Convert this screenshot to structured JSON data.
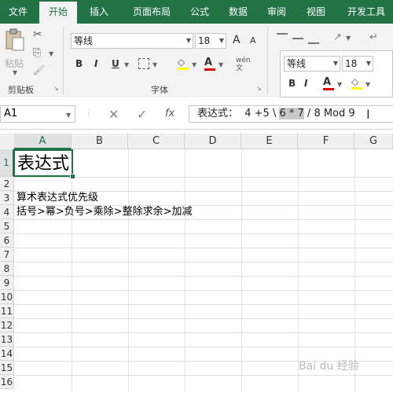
{
  "tabs": [
    "文件",
    "开始",
    "插入",
    "页面布局",
    "公式",
    "数据",
    "审阅",
    "视图",
    "开发工具"
  ],
  "ribbon": {
    "clipboard": {
      "paste": "粘贴",
      "label": "剪贴板"
    },
    "font": {
      "family": "等线",
      "size": "18",
      "label": "字体",
      "bold": "B",
      "italic": "I",
      "underline": "U",
      "grow": "A",
      "shrink": "A",
      "wen": "wén 文"
    },
    "font2": {
      "family": "等线",
      "size": "18",
      "bold": "B",
      "italic": "I"
    },
    "color_font": "#e00000"
  },
  "formula_bar": {
    "name_box": "A1",
    "fx": "fx",
    "formula_pre": "表达式：  4 +5 \\ ",
    "formula_hl": "6 * 7",
    "formula_post": " / 8 Mod 9"
  },
  "grid": {
    "columns": [
      "A",
      "B",
      "C",
      "D",
      "E",
      "F",
      "G"
    ],
    "rows": [
      "1",
      "2",
      "3",
      "4",
      "5",
      "6",
      "7",
      "8",
      "9",
      "10",
      "11",
      "12",
      "13",
      "14",
      "15",
      "16"
    ],
    "cells": {
      "a1": "表达式",
      "a3": "算术表达式优先级",
      "a4": "括号>幂>负号>乘除>整除求余>加减"
    }
  },
  "watermark": "Bai du 经验",
  "colors": {
    "accent": "#217346",
    "ribbon_bg": "#f3f3f3"
  }
}
